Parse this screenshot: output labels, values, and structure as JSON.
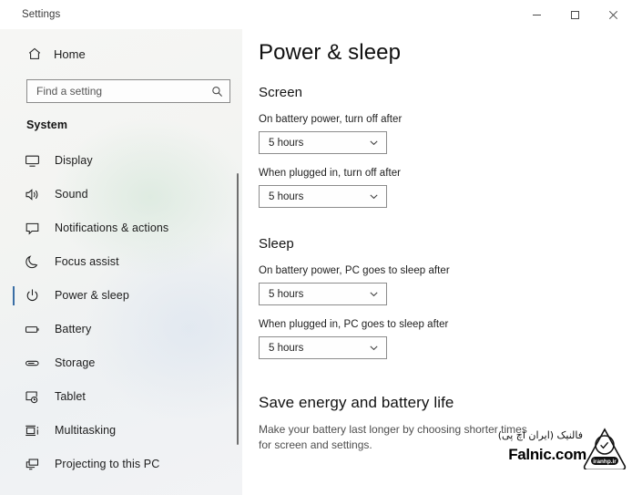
{
  "window": {
    "title": "Settings",
    "controls": [
      {
        "name": "minimize",
        "glyph": "minimize-icon",
        "label": "Minimize"
      },
      {
        "name": "maximize",
        "glyph": "maximize-icon",
        "label": "Maximize"
      },
      {
        "name": "close",
        "glyph": "close-icon",
        "label": "Close"
      }
    ]
  },
  "sidebar": {
    "home": {
      "label": "Home",
      "icon": "home-icon"
    },
    "search": {
      "placeholder": "Find a setting",
      "value": "",
      "icon": "search-icon"
    },
    "group_label": "System",
    "accent_color": "#3a6ea5",
    "items": [
      {
        "label": "Display",
        "icon": "display-icon",
        "selected": false
      },
      {
        "label": "Sound",
        "icon": "sound-icon",
        "selected": false
      },
      {
        "label": "Notifications & actions",
        "icon": "notifications-icon",
        "selected": false
      },
      {
        "label": "Focus assist",
        "icon": "moon-icon",
        "selected": false
      },
      {
        "label": "Power & sleep",
        "icon": "power-icon",
        "selected": true
      },
      {
        "label": "Battery",
        "icon": "battery-icon",
        "selected": false
      },
      {
        "label": "Storage",
        "icon": "storage-icon",
        "selected": false
      },
      {
        "label": "Tablet",
        "icon": "tablet-icon",
        "selected": false
      },
      {
        "label": "Multitasking",
        "icon": "multitasking-icon",
        "selected": false
      },
      {
        "label": "Projecting to this PC",
        "icon": "projecting-icon",
        "selected": false
      }
    ]
  },
  "main": {
    "page_title": "Power & sleep",
    "screen": {
      "heading": "Screen",
      "fields": [
        {
          "label": "On battery power, turn off after",
          "value": "5 hours"
        },
        {
          "label": "When plugged in, turn off after",
          "value": "5 hours"
        }
      ]
    },
    "sleep": {
      "heading": "Sleep",
      "fields": [
        {
          "label": "On battery power, PC goes to sleep after",
          "value": "5 hours"
        },
        {
          "label": "When plugged in, PC goes to sleep after",
          "value": "5 hours"
        }
      ]
    },
    "save_energy": {
      "title": "Save energy and battery life",
      "description": "Make your battery last longer by choosing shorter times for screen and settings."
    }
  },
  "watermark": {
    "persian": "فالنیک (ایران اچ پی)",
    "brand": "Falnic.com",
    "logo_text": "iranhp.ir"
  }
}
